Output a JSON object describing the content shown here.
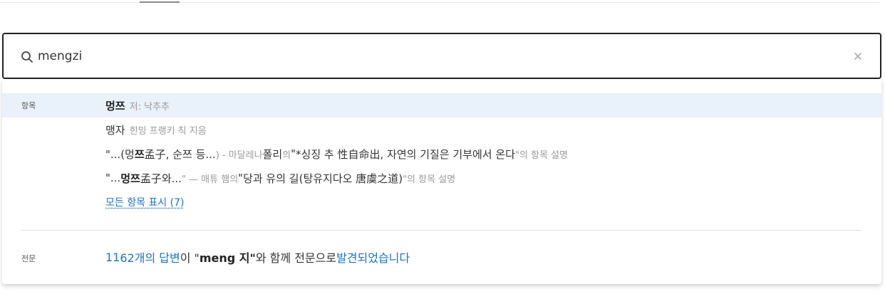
{
  "search": {
    "query": "mengzi",
    "placeholder": ""
  },
  "icons": {
    "search": "search-icon",
    "clear": "close-icon"
  },
  "colors": {
    "link": "#1a73c8",
    "highlight": "#e9f1fa",
    "input_border": "#222222"
  },
  "sections": {
    "items_label": "항목",
    "fulltext_label": "전문"
  },
  "items": [
    {
      "title": "멍쯔",
      "meta": "저: 낙추추"
    },
    {
      "title": "맹자",
      "meta": "힌밍 프랭키 칙 지음"
    },
    {
      "open": "\"...(멍",
      "match": "쯔",
      "rest": " 孟子, 순쯔 등...",
      "close_meta": ") - 마달레나 ",
      "author": "폴리",
      "author_suffix": "의 ",
      "quote_open": "\"",
      "entry_title": "*싱징 추 性自命出, 자연의 기질은 기부에서 온다",
      "quote_close_meta": "\"의 항목 설명"
    },
    {
      "open": "\"...",
      "match": "멍쯔",
      "rest": " 孟子와...",
      "close_meta": "\" — 매튜 햄의 ",
      "quote_open": "\"",
      "entry_title": "당과 유의 길(탕유지다오 唐虞之道)",
      "quote_close_meta": "\"의 항목 설명"
    }
  ],
  "show_all": "모든 항목 표시 (7)",
  "fulltext": {
    "count_prefix": "11",
    "count_link": "62개의 답변",
    "middle": "이 \"",
    "query": "meng 지\"",
    "suffix": "와 함께 전문으로 ",
    "found_link": "발견되었습니다"
  }
}
